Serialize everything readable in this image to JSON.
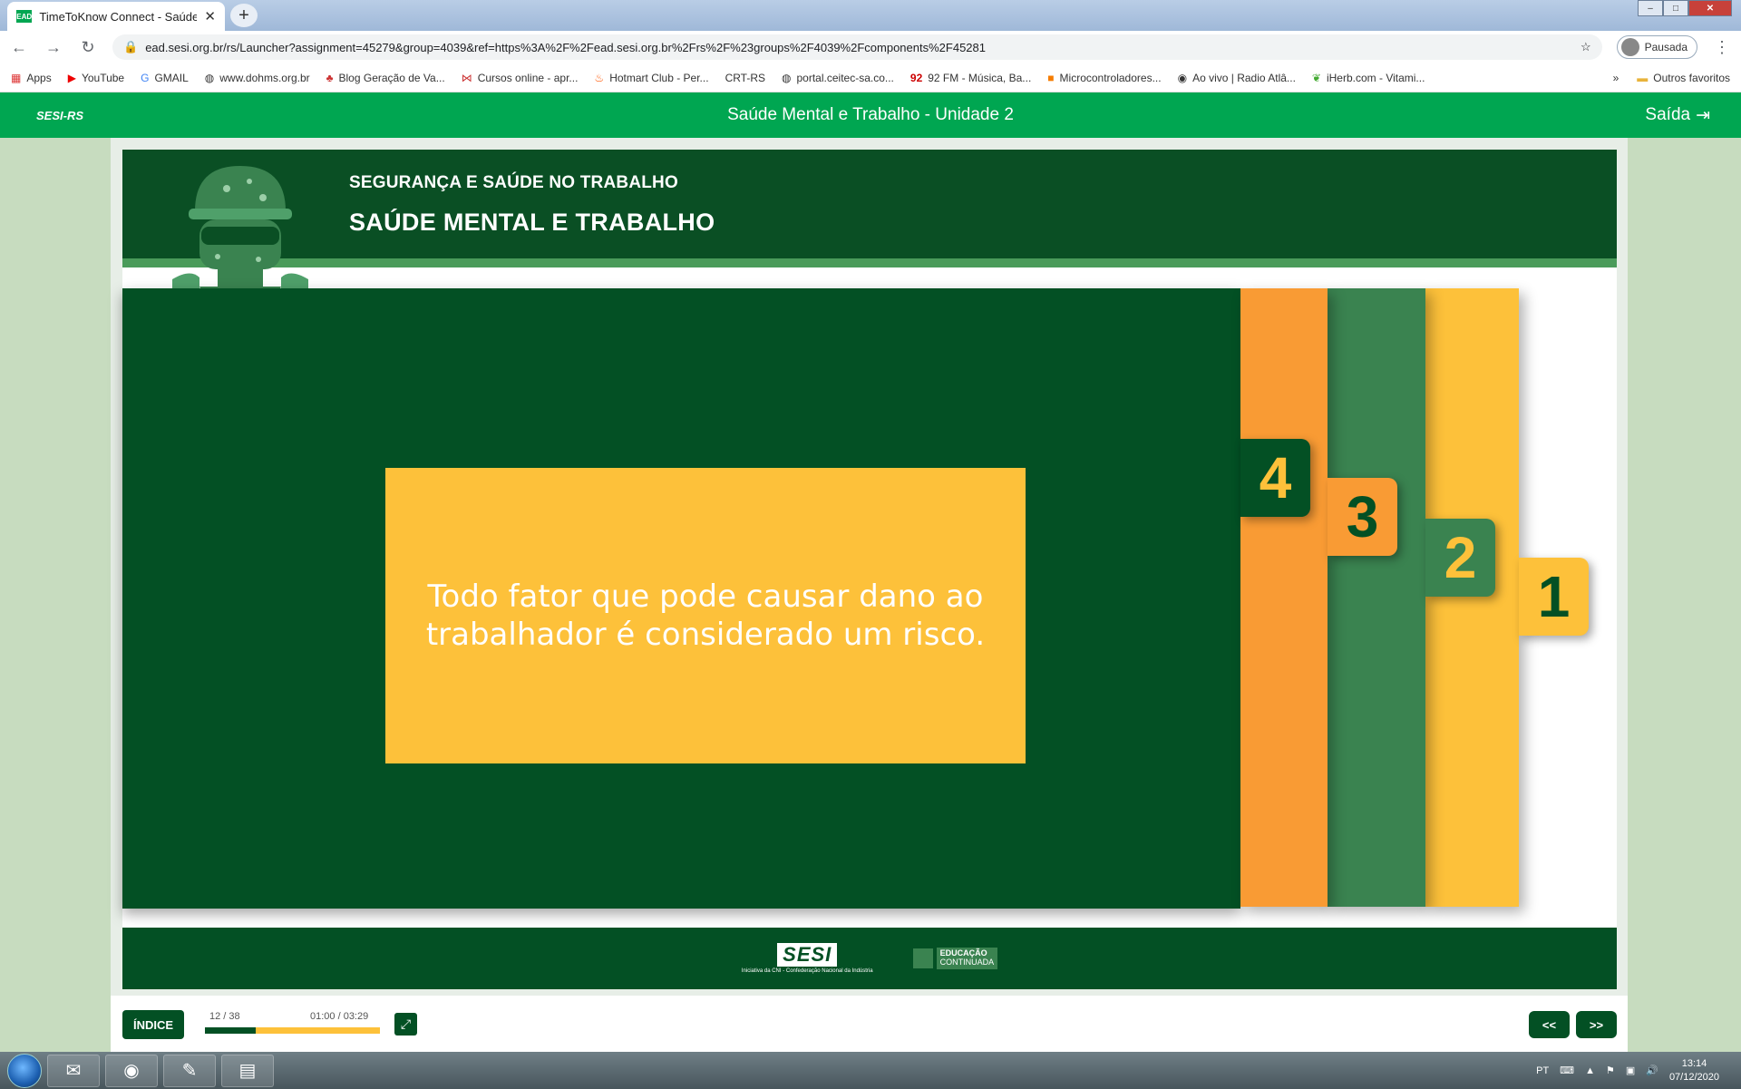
{
  "browser": {
    "tab_title": "TimeToKnow Connect - Saúde M",
    "tab_favicon": "EAD",
    "url": "ead.sesi.org.br/rs/Launcher?assignment=45279&group=4039&ref=https%3A%2F%2Fead.sesi.org.br%2Frs%2F%23groups%2F4039%2Fcomponents%2F45281",
    "profile_label": "Pausada",
    "bookmarks": [
      "Apps",
      "YouTube",
      "GMAIL",
      "www.dohms.org.br",
      "Blog Geração de Va...",
      "Cursos online - apr...",
      "Hotmart Club - Per...",
      "CRT-RS",
      "portal.ceitec-sa.co...",
      "92 FM - Música, Ba...",
      "Microcontroladores...",
      "Ao vivo | Radio Atlâ...",
      "iHerb.com - Vitami..."
    ],
    "bookmarks_more": "»",
    "other_bookmarks": "Outros favoritos"
  },
  "app": {
    "brand": "SESI-RS",
    "title": "Saúde Mental e Trabalho - Unidade 2",
    "exit_label": "Saída"
  },
  "slide": {
    "kicker": "SEGURANÇA E SAÚDE NO TRABALHO",
    "title": "SAÚDE MENTAL E TRABALHO",
    "card_text": "Todo fator que pode causar dano ao trabalhador é considerado um risco.",
    "tabs": [
      "4",
      "3",
      "2",
      "1"
    ],
    "footer": {
      "sesi": "SESI",
      "sesi_tagline": "Iniciativa da CNI - Confederação Nacional da Indústria",
      "edu_line1": "EDUCAÇÃO",
      "edu_line2": "CONTINUADA"
    }
  },
  "player": {
    "index_label": "ÍNDICE",
    "page": "12 / 38",
    "time": "01:00 / 03:29",
    "progress": 0.29,
    "prev_label": "<<",
    "next_label": ">>"
  },
  "taskbar": {
    "lang": "PT",
    "time": "13:14",
    "date": "07/12/2020"
  },
  "colors": {
    "dark_green": "#035024",
    "bright_green": "#00a651",
    "mid_green": "#3a8350",
    "yellow": "#fdc13a",
    "orange": "#f99b34"
  }
}
